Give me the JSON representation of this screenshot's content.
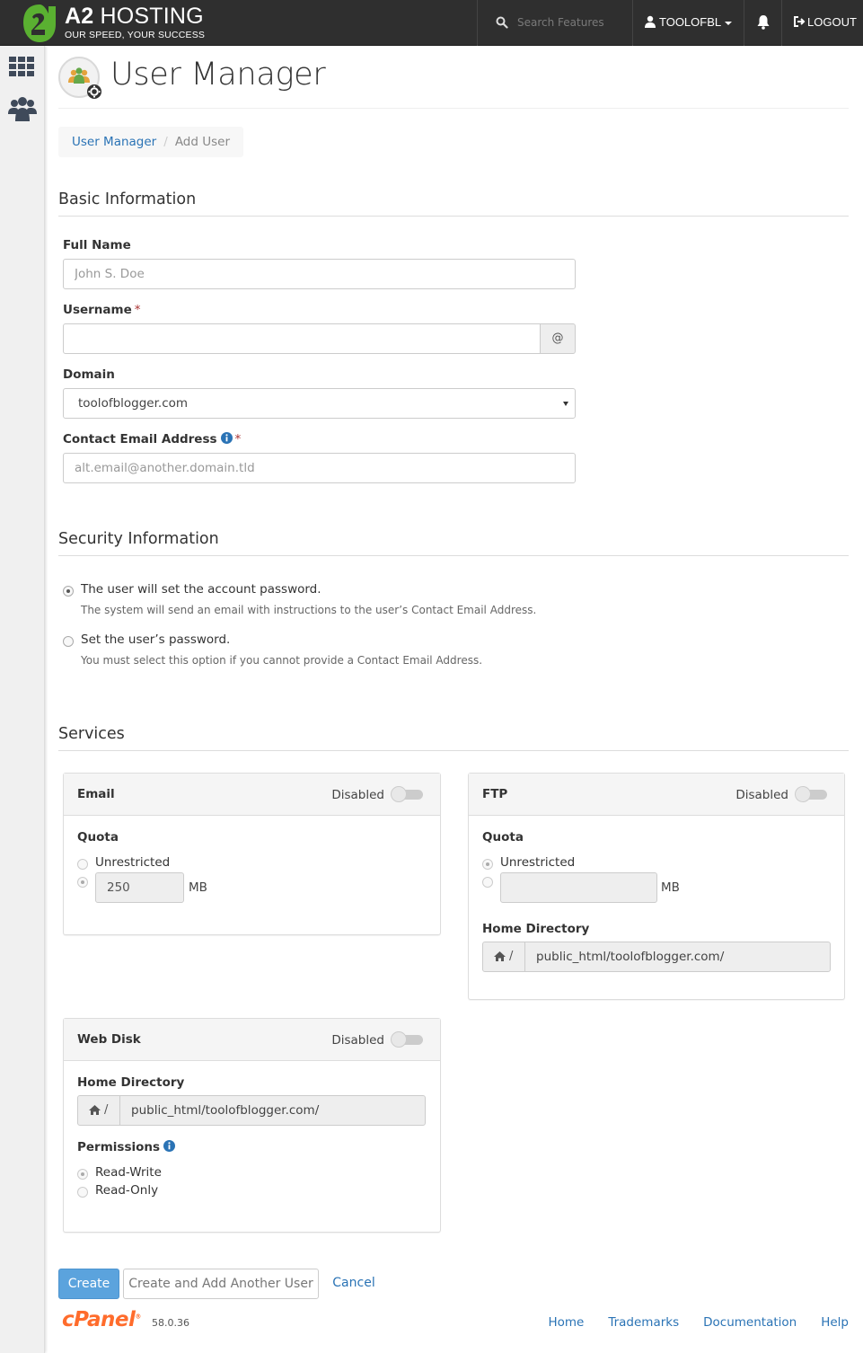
{
  "header": {
    "brand_title_bold": "A2",
    "brand_title_rest": " HOSTING",
    "brand_tagline": "OUR SPEED, YOUR SUCCESS",
    "search_placeholder": "Search Features",
    "username": "TOOLOFBL",
    "logout_label": "LOGOUT",
    "brand_color": "#5ab031"
  },
  "page": {
    "title": "User Manager",
    "breadcrumb": [
      "User Manager",
      "Add User"
    ]
  },
  "basic": {
    "heading": "Basic Information",
    "full_name_label": "Full Name",
    "full_name_placeholder": "John S. Doe",
    "username_label": "Username",
    "username_value": "",
    "username_addon": "@",
    "domain_label": "Domain",
    "domain_value": "toolofblogger.com",
    "email_label": "Contact Email Address",
    "email_placeholder": "alt.email@another.domain.tld",
    "required_mark": "*"
  },
  "security": {
    "heading": "Security Information",
    "options": [
      {
        "label": "The user will set the account password.",
        "help": "The system will send an email with instructions to the user’s Contact Email Address.",
        "selected": true
      },
      {
        "label": "Set the user’s password.",
        "help": "You must select this option if you cannot provide a Contact Email Address.",
        "selected": false
      }
    ]
  },
  "services": {
    "heading": "Services",
    "email": {
      "title": "Email",
      "state": "Disabled",
      "quota_label": "Quota",
      "unrestricted_label": "Unrestricted",
      "quota_value": "250",
      "unit": "MB"
    },
    "ftp": {
      "title": "FTP",
      "state": "Disabled",
      "quota_label": "Quota",
      "unrestricted_label": "Unrestricted",
      "quota_value": "",
      "unit": "MB",
      "homedir_label": "Home Directory",
      "homedir_prefix": "/",
      "homedir_value": "public_html/toolofblogger.com/"
    },
    "webdisk": {
      "title": "Web Disk",
      "state": "Disabled",
      "homedir_label": "Home Directory",
      "homedir_prefix": "/",
      "homedir_value": "public_html/toolofblogger.com/",
      "permissions_label": "Permissions",
      "perm_options": [
        "Read-Write",
        "Read-Only"
      ]
    }
  },
  "actions": {
    "create": "Create",
    "create_another": "Create and Add Another User",
    "cancel": "Cancel"
  },
  "footer": {
    "logo_text": "cPanel",
    "logo_mark": "®",
    "version": "58.0.36",
    "links": [
      "Home",
      "Trademarks",
      "Documentation",
      "Help"
    ]
  }
}
